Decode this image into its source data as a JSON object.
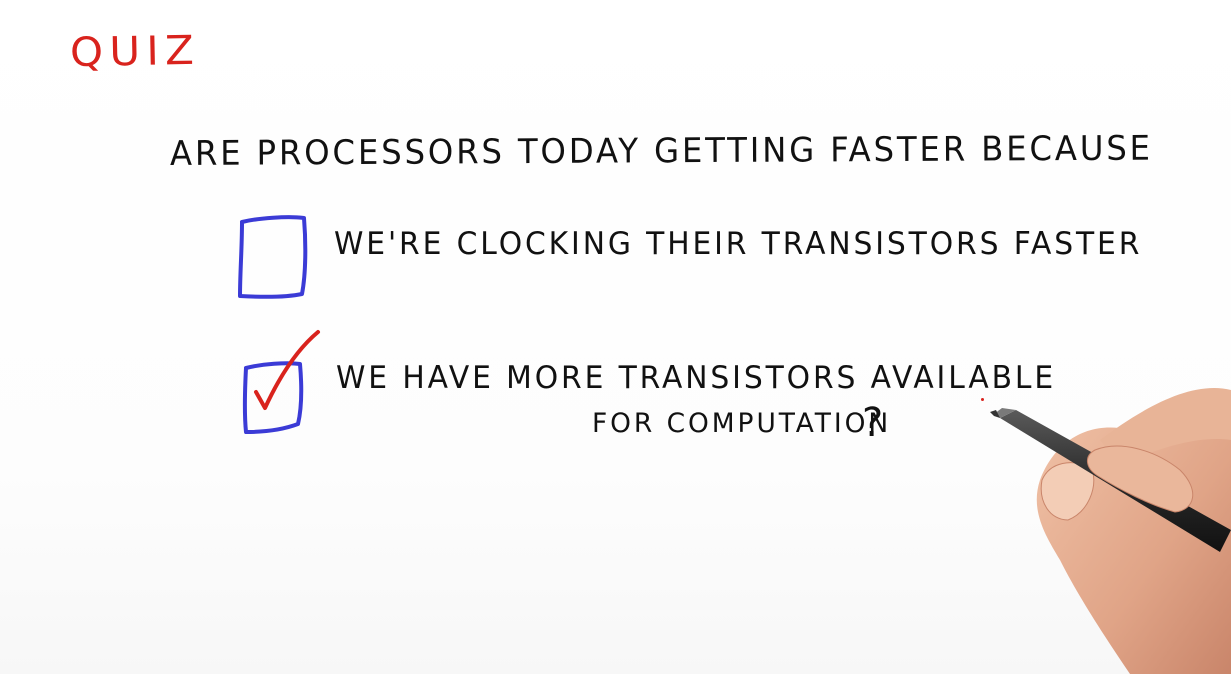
{
  "quiz": {
    "title": "QUIZ",
    "question": "ARE PROCESSORS TODAY GETTING FASTER BECAUSE",
    "options": [
      {
        "text": "WE'RE CLOCKING THEIR TRANSISTORS FASTER",
        "checked": false
      },
      {
        "line1": "WE HAVE MORE TRANSISTORS AVAILABLE",
        "line2": "FOR COMPUTATION",
        "checked": true
      }
    ],
    "end_mark": "?"
  },
  "colors": {
    "title": "#d9231d",
    "ink": "#111111",
    "checkbox": "#3b3bd6",
    "checkmark": "#d9231d"
  }
}
